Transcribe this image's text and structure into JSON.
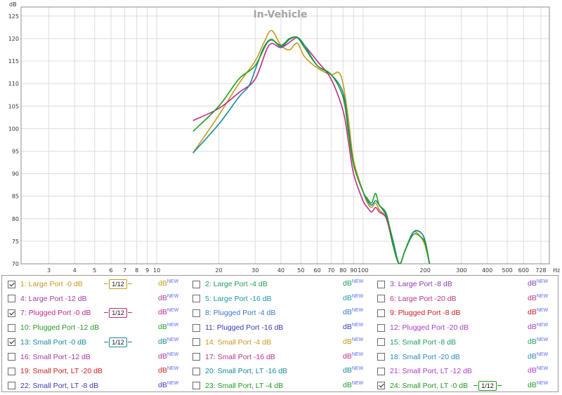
{
  "chart_data": {
    "type": "line",
    "title": "In-Vehicle",
    "ylabel": "dB",
    "xunit": "Hz",
    "xscale": "log",
    "xlim": [
      2.2,
      800
    ],
    "ylim": [
      70,
      127
    ],
    "grid": true,
    "xticks": [
      {
        "v": 3,
        "t": "3"
      },
      {
        "v": 4,
        "t": "4"
      },
      {
        "v": 5,
        "t": "5"
      },
      {
        "v": 6,
        "t": "6"
      },
      {
        "v": 7,
        "t": "7"
      },
      {
        "v": 8,
        "t": "8"
      },
      {
        "v": 9,
        "t": "9"
      },
      {
        "v": 10,
        "t": "10"
      },
      {
        "v": 20,
        "t": "20"
      },
      {
        "v": 30,
        "t": "30"
      },
      {
        "v": 40,
        "t": "40"
      },
      {
        "v": 50,
        "t": "50"
      },
      {
        "v": 60,
        "t": "60"
      },
      {
        "v": 70,
        "t": "70"
      },
      {
        "v": 80,
        "t": "80"
      },
      {
        "v": 90,
        "t": "90"
      },
      {
        "v": 100,
        "t": "100"
      },
      {
        "v": 200,
        "t": "200"
      },
      {
        "v": 300,
        "t": "300"
      },
      {
        "v": 400,
        "t": "400"
      },
      {
        "v": 500,
        "t": "500"
      },
      {
        "v": 600,
        "t": "600"
      },
      {
        "v": 728,
        "t": "728"
      }
    ],
    "yticks": [
      70,
      75,
      80,
      85,
      90,
      95,
      100,
      105,
      110,
      115,
      120,
      125
    ],
    "series": [
      {
        "name": "1: Large Port -0 dB",
        "color": "#c49a1c",
        "x": [
          15,
          20,
          25,
          30,
          33,
          36,
          40,
          44,
          48,
          52,
          60,
          70,
          76,
          80,
          85,
          90,
          100,
          105,
          110,
          115,
          120,
          130,
          140,
          150,
          160,
          175,
          190,
          200,
          210
        ],
        "y": [
          94.6,
          103,
          110,
          115,
          119,
          121.8,
          118.5,
          117.5,
          119,
          116,
          113.5,
          112,
          112.5,
          110,
          102,
          93,
          86,
          83.5,
          82.5,
          83.5,
          82,
          80,
          74,
          70,
          73,
          77,
          76,
          74,
          70
        ]
      },
      {
        "name": "7: Plugged Port -0 dB",
        "color": "#c0288b",
        "x": [
          15,
          20,
          25,
          30,
          35,
          40,
          45,
          48,
          52,
          60,
          70,
          80,
          85,
          90,
          100,
          105,
          110,
          115,
          120,
          130,
          140,
          150,
          160,
          175,
          190,
          200,
          210
        ],
        "y": [
          101.8,
          104.5,
          108,
          111,
          118.5,
          118,
          119.5,
          120.2,
          118.5,
          115,
          111,
          104,
          97,
          90,
          84,
          82.5,
          81.5,
          82.5,
          81.5,
          80,
          74,
          70,
          73,
          77,
          77,
          75,
          70
        ]
      },
      {
        "name": "13: Small Port -0 dB",
        "color": "#168a96",
        "x": [
          15,
          20,
          25,
          28,
          30,
          33,
          36,
          40,
          44,
          48,
          52,
          60,
          70,
          80,
          85,
          90,
          100,
          105,
          110,
          115,
          120,
          130,
          140,
          150,
          160,
          175,
          190,
          200,
          210
        ],
        "y": [
          94.6,
          101,
          107,
          109.5,
          113,
          118,
          119.8,
          118.2,
          119.8,
          120.3,
          118.5,
          114,
          112,
          108,
          100,
          92,
          86,
          84,
          83,
          84,
          83,
          80.5,
          75,
          70,
          73,
          77,
          77,
          75,
          70
        ]
      },
      {
        "name": "24: Small Port, LT -0 dB",
        "color": "#1f9c1f",
        "x": [
          15,
          20,
          25,
          30,
          35,
          40,
          44,
          48,
          52,
          60,
          70,
          80,
          85,
          90,
          100,
          105,
          110,
          115,
          120,
          130,
          140,
          150,
          160,
          175,
          190,
          200,
          210
        ],
        "y": [
          99.4,
          105,
          111,
          114,
          119.5,
          118.5,
          120,
          120.2,
          118,
          114,
          112,
          107,
          99,
          92,
          86,
          84.5,
          83.5,
          85.6,
          83,
          81,
          74,
          70,
          73,
          76.5,
          76,
          74.5,
          70
        ]
      }
    ]
  },
  "legend": {
    "items": [
      {
        "label": "1: Large Port -0 dB",
        "color": "#c49a1c",
        "checked": true,
        "smoothing": "1/12"
      },
      {
        "label": "2: Large Port -4 dB",
        "color": "#1f9c5a",
        "checked": false
      },
      {
        "label": "3: Large Port -8 dB",
        "color": "#8a3cb4",
        "checked": false
      },
      {
        "label": "4: Large Port -12 dB",
        "color": "#a23ba0",
        "checked": false
      },
      {
        "label": "5: Large Port -16 dB",
        "color": "#1c9aa8",
        "checked": false
      },
      {
        "label": "6: Large Port -20 dB",
        "color": "#b7358c",
        "checked": false
      },
      {
        "label": "7: Plugged Port -0 dB",
        "color": "#c0288b",
        "checked": true,
        "smoothing": "1/12"
      },
      {
        "label": "8: Plugged Port -4 dB",
        "color": "#3c78c8",
        "checked": false
      },
      {
        "label": "9: Plugged Port -8 dB",
        "color": "#c8201e",
        "checked": false
      },
      {
        "label": "10: Plugged Port -12 dB",
        "color": "#2a9a2a",
        "checked": false
      },
      {
        "label": "11: Plugged Port -16 dB",
        "color": "#3a3ab4",
        "checked": false
      },
      {
        "label": "12: Plugged Port -20 dB",
        "color": "#a840c8",
        "checked": false
      },
      {
        "label": "13: Small Port -0 dB",
        "color": "#168a96",
        "checked": true,
        "smoothing": "1/12"
      },
      {
        "label": "14: Small Port -4 dB",
        "color": "#c49a1c",
        "checked": false
      },
      {
        "label": "15: Small Port -8 dB",
        "color": "#1f9c5a",
        "checked": false
      },
      {
        "label": "16: Small Port -12 dB",
        "color": "#a23ba0",
        "checked": false
      },
      {
        "label": "17: Small Port -16 dB",
        "color": "#b7358c",
        "checked": false
      },
      {
        "label": "18: Small Port -20 dB",
        "color": "#2a8ab4",
        "checked": false
      },
      {
        "label": "19: Small Port, LT -20 dB",
        "color": "#c8201e",
        "checked": false
      },
      {
        "label": "20: Small Port, LT -16 dB",
        "color": "#168a96",
        "checked": false
      },
      {
        "label": "21: Small Port, LT -12 dB",
        "color": "#a840c8",
        "checked": false
      },
      {
        "label": "22: Small Port, LT -8 dB",
        "color": "#3a3ab4",
        "checked": false
      },
      {
        "label": "23: Small Port, LT -4 dB",
        "color": "#1f9c1f",
        "checked": false
      },
      {
        "label": "24: Small Port, LT -0 dB",
        "color": "#1f9c1f",
        "checked": true,
        "smoothing": "1/12"
      }
    ],
    "unit_label": "dB",
    "unit_sup": "NEW"
  }
}
